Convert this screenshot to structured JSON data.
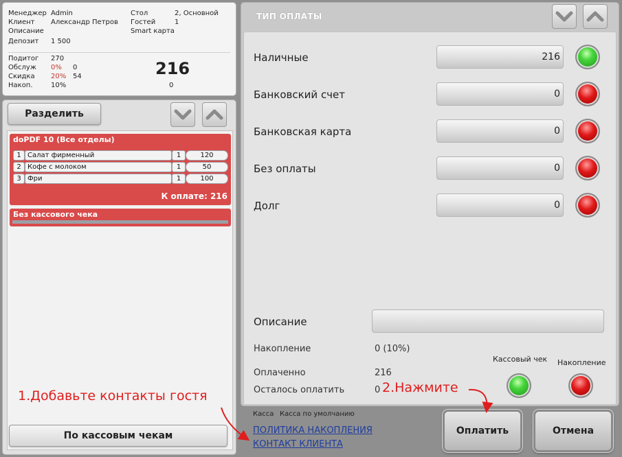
{
  "info": {
    "manager_label": "Менеджер",
    "manager_value": "Admin",
    "client_label": "Клиент",
    "client_value": "Александр Петров",
    "description_label": "Описание",
    "deposit_label": "Депозит",
    "deposit_value": "1 500",
    "table_label": "Стол",
    "table_value": "2, Основной",
    "guests_label": "Гостей",
    "guests_value": "1",
    "card_label": "Smart карта",
    "subtotal_label": "Подитог",
    "subtotal_value": "270",
    "service_label": "Обслуж",
    "service_pct": "0%",
    "service_value": "0",
    "discount_label": "Скидка",
    "discount_pct": "20%",
    "discount_value": "54",
    "accum_label": "Накоп.",
    "accum_pct": "10%",
    "accum_value": "0",
    "total": "216"
  },
  "order": {
    "split_label": "Разделить",
    "receipts_button": "По кассовым чекам",
    "receipt1": {
      "title": "doPDF 10 (Все отделы)",
      "lines": [
        {
          "n": "1",
          "name": "Салат фирменный",
          "qty": "1",
          "price": "120"
        },
        {
          "n": "2",
          "name": "Кофе с молоком",
          "qty": "1",
          "price": "50"
        },
        {
          "n": "3",
          "name": "Фри",
          "qty": "1",
          "price": "100"
        }
      ],
      "total_label": "К оплате: 216"
    },
    "receipt2": {
      "title": "Без кассового чека"
    }
  },
  "payment": {
    "title": "ТИП ОПЛАТЫ",
    "methods": [
      {
        "label": "Наличные",
        "value": "216",
        "status": "green"
      },
      {
        "label": "Банковский счет",
        "value": "0",
        "status": "red"
      },
      {
        "label": "Банковская карта",
        "value": "0",
        "status": "red"
      },
      {
        "label": "Без оплаты",
        "value": "0",
        "status": "red"
      },
      {
        "label": "Долг",
        "value": "0",
        "status": "red"
      }
    ],
    "description_label": "Описание",
    "accumulation_label": "Накопление",
    "accumulation_value": "0 (10%)",
    "paid_label": "Оплаченно",
    "paid_value": "216",
    "remaining_label": "Осталось оплатить",
    "remaining_value": "0",
    "receipt_toggle_label": "Кассовый чек",
    "accum_toggle_label": "Накопление",
    "cashbox_label": "Касса",
    "cashbox_value": "Касса по умолчанию",
    "link_policy": "ПОЛИТИКА НАКОПЛЕНИЯ",
    "link_contact": "КОНТАКТ КЛИЕНТА",
    "pay_button": "Оплатить",
    "cancel_button": "Отмена"
  },
  "annotations": {
    "step1": "1.Добавьте контакты гостя",
    "step2": "2.Нажмите"
  },
  "colors": {
    "green": "#2ec82a",
    "red": "#d81a1a",
    "annotation": "#e01d1d"
  }
}
